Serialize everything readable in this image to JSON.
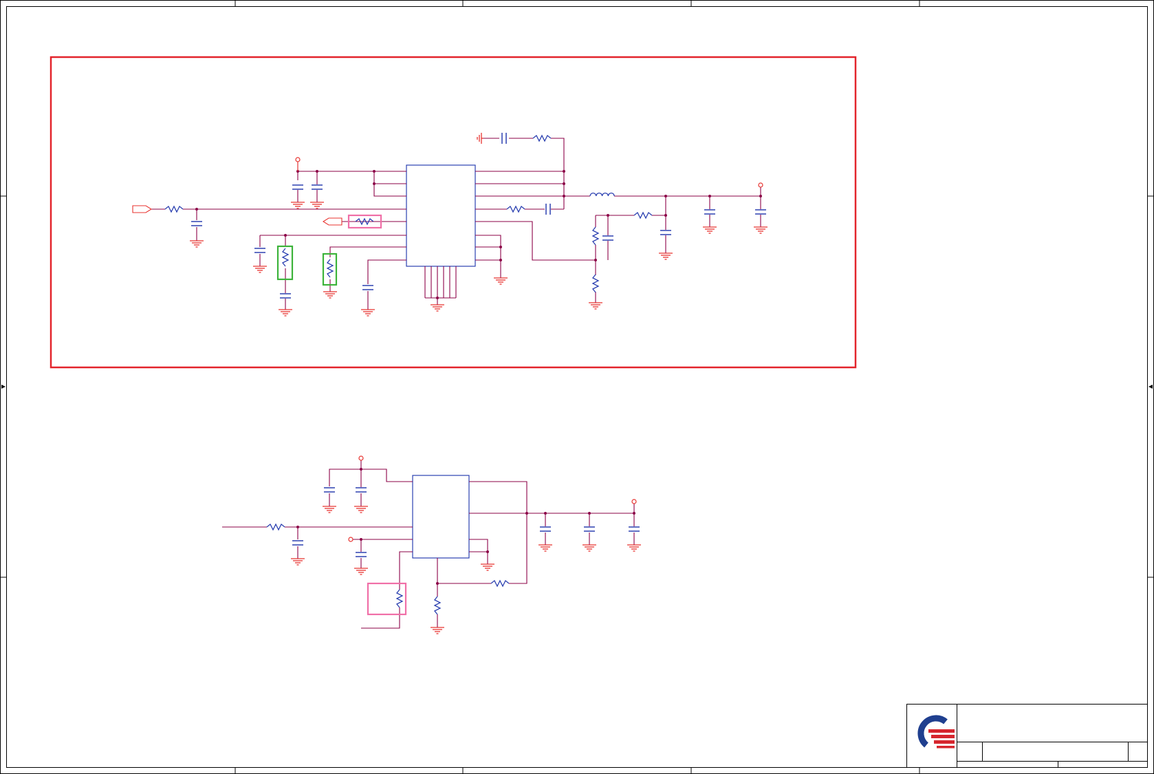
{
  "colors": {
    "frame": "#000000",
    "wire": "#8b0046",
    "component": "#2a3fb0",
    "power": "#e8332f",
    "highlight_red": "#e3242b",
    "highlight_green": "#3cb33a",
    "highlight_pink": "#f06fa7",
    "logo_blue": "#1f3f8f",
    "logo_red": "#d6262e"
  },
  "icons": {
    "logo": "company-logo-icon",
    "resistor": "resistor-symbol",
    "capacitor": "capacitor-symbol",
    "inductor": "inductor-symbol",
    "ground": "ground-symbol",
    "power_pin": "power-pin-symbol"
  },
  "title_block": {
    "title": "",
    "size": "",
    "document_number": "",
    "rev": "",
    "date": "",
    "sheet": ""
  }
}
